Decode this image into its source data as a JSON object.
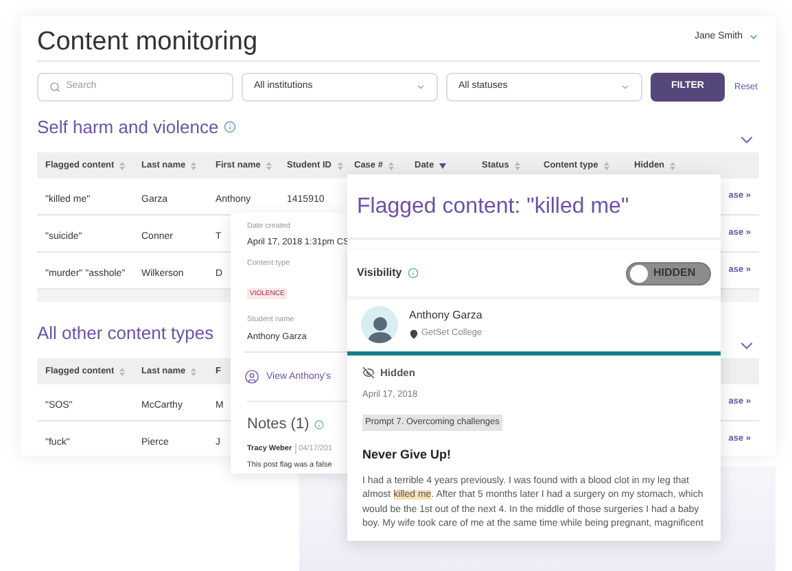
{
  "page_title": "Content monitoring",
  "user": {
    "name": "Jane Smith"
  },
  "filters": {
    "search": {
      "placeholder": "Search"
    },
    "institution": "All institutions",
    "status": "All statuses",
    "filter_button": "FILTER",
    "reset": "Reset"
  },
  "sections": [
    {
      "title": "Self harm and violence",
      "columns": [
        {
          "label": "Flagged content",
          "sorted": false
        },
        {
          "label": "Last name",
          "sorted": false
        },
        {
          "label": "First name",
          "sorted": false
        },
        {
          "label": "Student ID",
          "sorted": false
        },
        {
          "label": "Case #",
          "sorted": false
        },
        {
          "label": "Date",
          "sorted": true
        },
        {
          "label": "Status",
          "sorted": false
        },
        {
          "label": "Content type",
          "sorted": false
        },
        {
          "label": "Hidden",
          "sorted": false
        }
      ],
      "rows": [
        {
          "cells": [
            "\"killed me\"",
            "Garza",
            "Anthony",
            "1415910"
          ],
          "link": "ase »"
        },
        {
          "cells": [
            "\"suicide\"",
            "Conner",
            "T"
          ],
          "link": "ase »"
        },
        {
          "cells": [
            "\"murder\" \"asshole\"",
            "Wilkerson",
            "D"
          ],
          "link": "ase »"
        }
      ]
    },
    {
      "title": "All other content types",
      "columns": [
        {
          "label": "Flagged content",
          "sorted": false
        },
        {
          "label": "Last name",
          "sorted": false
        },
        {
          "label": "F"
        }
      ],
      "rows": [
        {
          "cells": [
            "\"SOS\"",
            "McCarthy",
            "M"
          ],
          "link": "ase »"
        },
        {
          "cells": [
            "\"fuck\"",
            "Pierce",
            "J"
          ],
          "link": "ase »"
        }
      ]
    }
  ],
  "detail_panel": {
    "fields": [
      {
        "label": "Date created",
        "value": "April 17, 2018 1:31pm CS",
        "kind": "text"
      },
      {
        "label": "Content type",
        "value": "VIOLENCE",
        "kind": "tag"
      },
      {
        "label": "Student name",
        "value": "Anthony Garza",
        "kind": "text"
      }
    ],
    "profile_link": "View Anthony's",
    "notes_title": "Notes (1)",
    "note": {
      "author": "Tracy Weber",
      "date": "04/17/201",
      "text": "This post flag was a false"
    }
  },
  "flagged_panel": {
    "title": "Flagged content: \"killed me\"",
    "visibility": {
      "label": "Visibility",
      "hidden": true,
      "toggle_label": "HIDDEN"
    },
    "student": {
      "name": "Anthony Garza",
      "school": "GetSet College"
    },
    "status": "Hidden",
    "date": "April 17, 2018",
    "prompt": "Prompt 7. Overcoming challenges",
    "heading": "Never Give Up!",
    "body": {
      "before": "I had a terrible 4 years previously. I was found with a blood clot in my leg that almost ",
      "highlight": "killed me",
      "after": ". After that 5 months later I had a surgery on my stomach, which would be the 1st out of the next 4. In the middle of those surgeries I had a baby boy. My wife took care of me at the same time while being pregnant, magnificent"
    }
  }
}
